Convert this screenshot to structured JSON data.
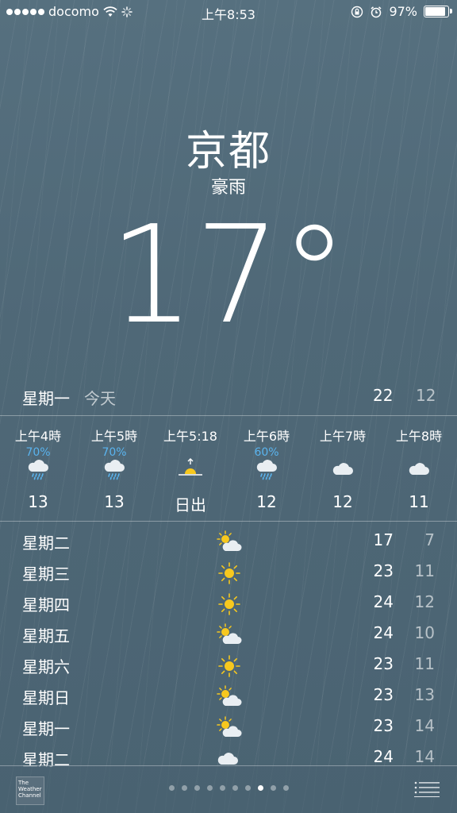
{
  "status": {
    "carrier": "docomo",
    "time": "上午8:53",
    "battery": "97%",
    "battery_level": 0.97
  },
  "location": {
    "city": "京都",
    "condition": "豪雨",
    "temperature": "17°"
  },
  "today": {
    "day": "星期一",
    "label": "今天",
    "high": "22",
    "low": "12"
  },
  "hourly": [
    {
      "time": "上午4時",
      "pop": "70%",
      "icon": "rain-cloud-icon",
      "temp": "13"
    },
    {
      "time": "上午5時",
      "pop": "70%",
      "icon": "rain-cloud-icon",
      "temp": "13"
    },
    {
      "time": "上午5:18",
      "pop": "",
      "icon": "sunrise-icon",
      "temp": "日出"
    },
    {
      "time": "上午6時",
      "pop": "60%",
      "icon": "rain-cloud-icon",
      "temp": "12"
    },
    {
      "time": "上午7時",
      "pop": "",
      "icon": "cloud-icon",
      "temp": "12"
    },
    {
      "time": "上午8時",
      "pop": "",
      "icon": "cloud-icon",
      "temp": "11"
    }
  ],
  "daily": [
    {
      "day": "星期二",
      "icon": "partly-cloudy-icon",
      "high": "17",
      "low": "7"
    },
    {
      "day": "星期三",
      "icon": "sun-icon",
      "high": "23",
      "low": "11"
    },
    {
      "day": "星期四",
      "icon": "sun-icon",
      "high": "24",
      "low": "12"
    },
    {
      "day": "星期五",
      "icon": "partly-cloudy-icon",
      "high": "24",
      "low": "10"
    },
    {
      "day": "星期六",
      "icon": "sun-icon",
      "high": "23",
      "low": "11"
    },
    {
      "day": "星期日",
      "icon": "partly-cloudy-icon",
      "high": "23",
      "low": "13"
    },
    {
      "day": "星期一",
      "icon": "partly-cloudy-icon",
      "high": "23",
      "low": "14"
    },
    {
      "day": "星期二",
      "icon": "cloud-icon",
      "high": "24",
      "low": "14"
    }
  ],
  "footer": {
    "logo_line1": "The",
    "logo_line2": "Weather",
    "logo_line3": "Channel",
    "page_count": 10,
    "active_page": 8
  },
  "colors": {
    "background": "#4f6877",
    "precip_blue": "#5ab4ef",
    "sun_yellow": "#f7c81e"
  }
}
